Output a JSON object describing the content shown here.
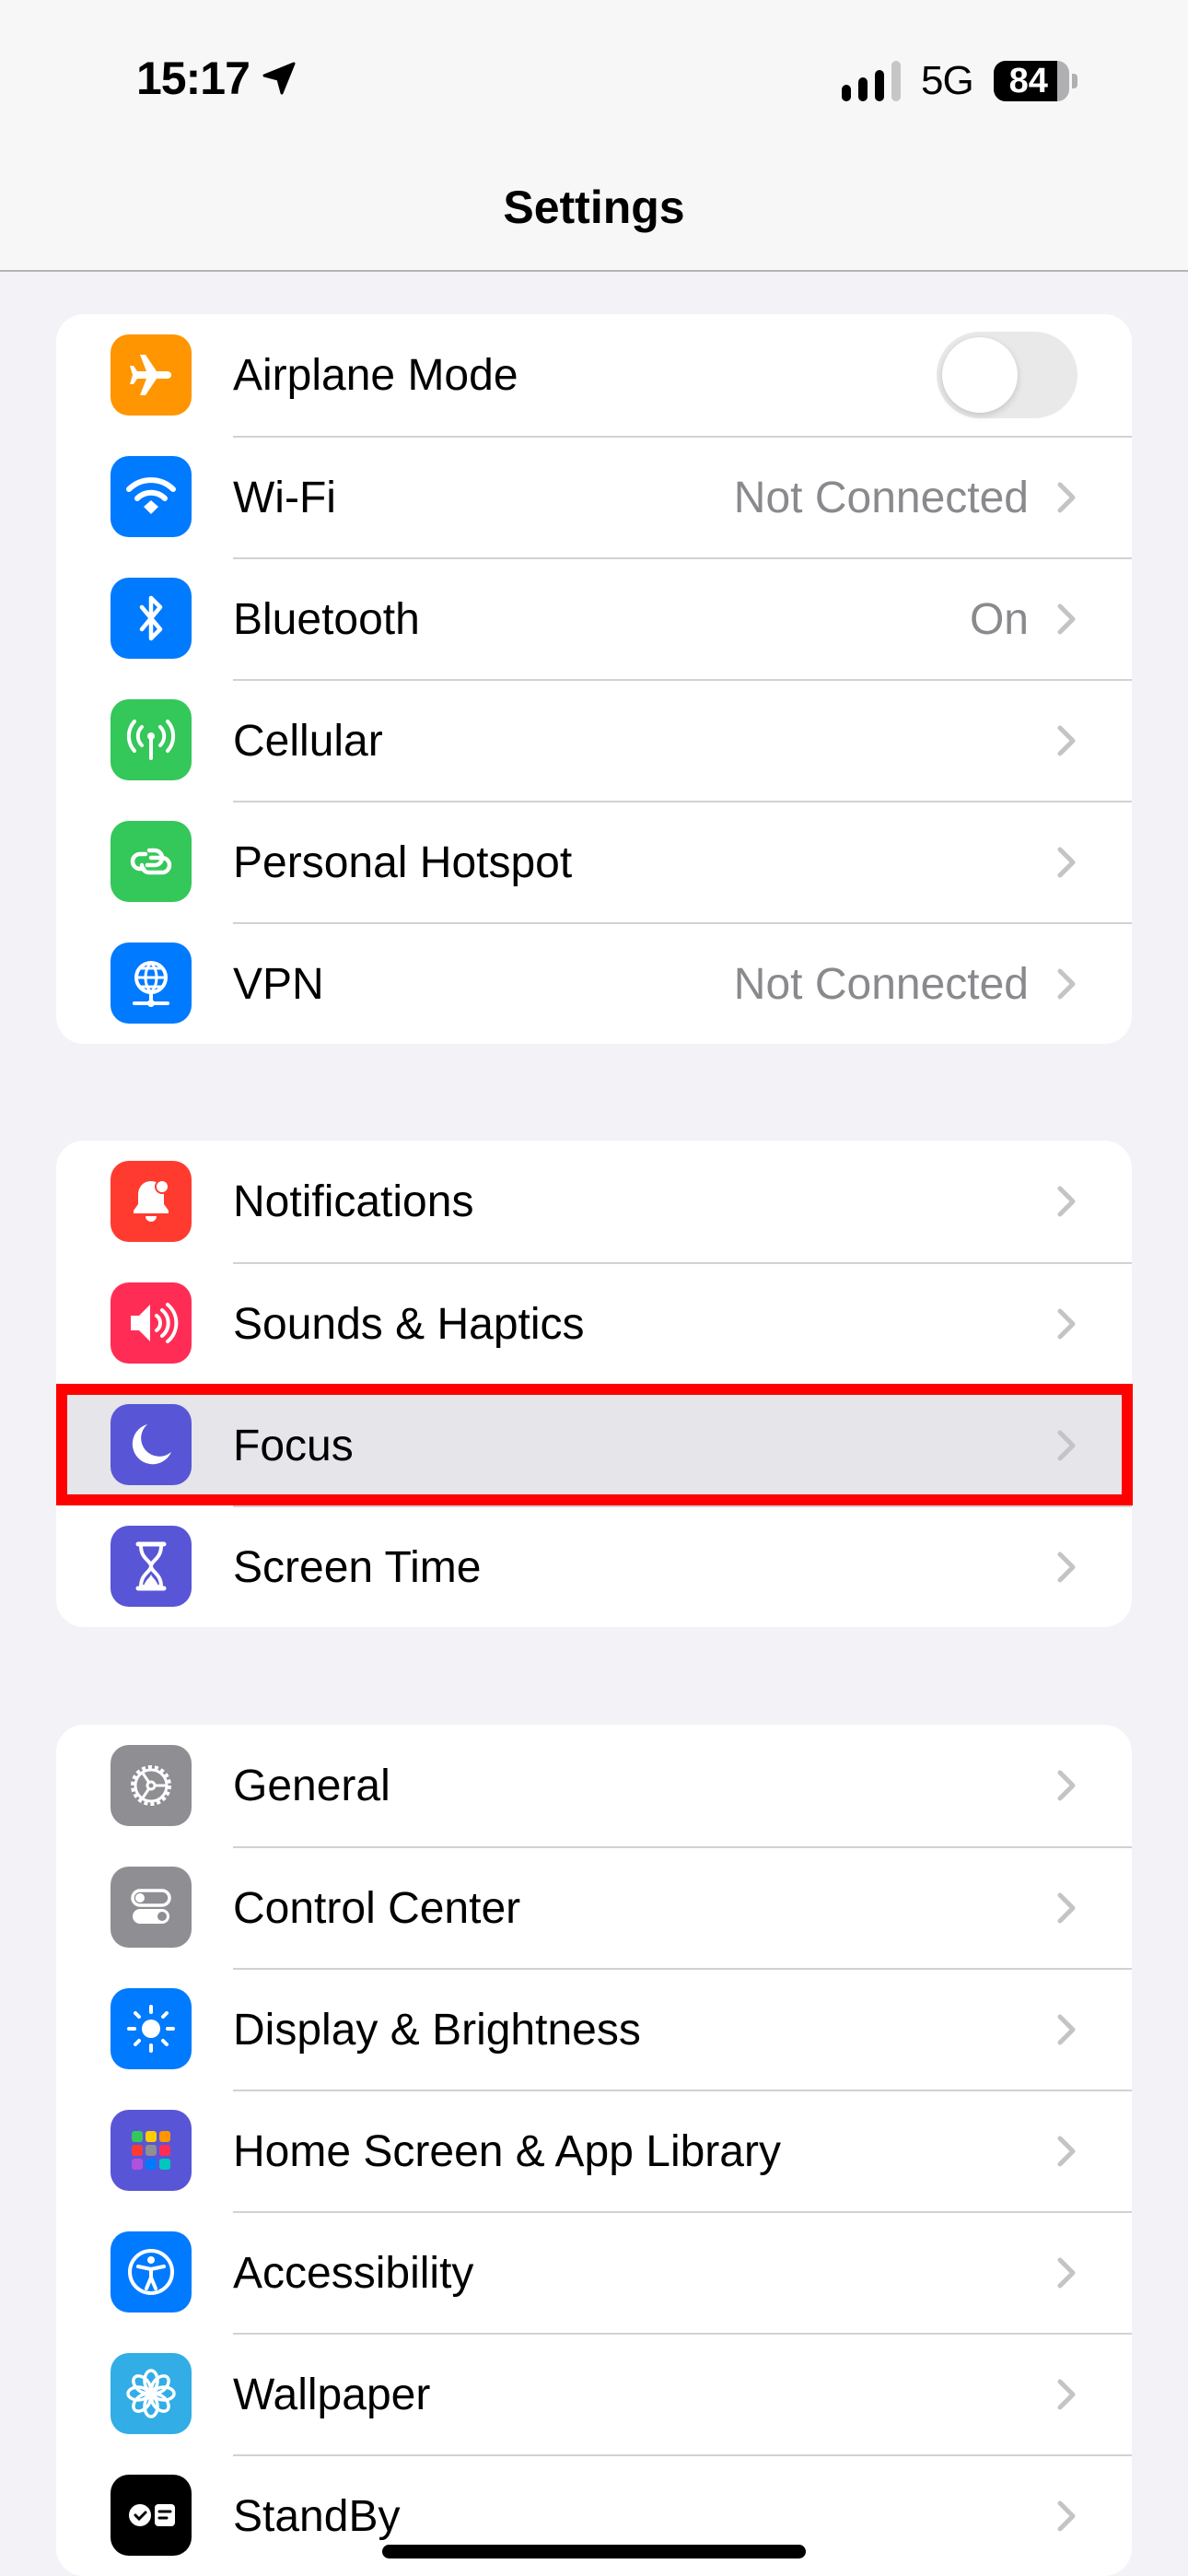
{
  "status_bar": {
    "time": "15:17",
    "location_icon": "location-arrow-icon",
    "signal_bars_active": 3,
    "signal_bars_total": 4,
    "network": "5G",
    "battery_percent": 84
  },
  "nav": {
    "title": "Settings"
  },
  "groups": [
    {
      "items": [
        {
          "label": "Airplane Mode",
          "icon": "airplane-icon",
          "color": "#ff9500",
          "toggle": false
        },
        {
          "label": "Wi-Fi",
          "icon": "wifi-icon",
          "color": "#007aff",
          "value": "Not Connected"
        },
        {
          "label": "Bluetooth",
          "icon": "bluetooth-icon",
          "color": "#007aff",
          "value": "On"
        },
        {
          "label": "Cellular",
          "icon": "cellular-antenna-icon",
          "color": "#34c759"
        },
        {
          "label": "Personal Hotspot",
          "icon": "hotspot-link-icon",
          "color": "#34c759"
        },
        {
          "label": "VPN",
          "icon": "vpn-globe-icon",
          "color": "#007aff",
          "value": "Not Connected"
        }
      ]
    },
    {
      "items": [
        {
          "label": "Notifications",
          "icon": "bell-icon",
          "color": "#ff3b30"
        },
        {
          "label": "Sounds & Haptics",
          "icon": "speaker-icon",
          "color": "#ff2d55"
        },
        {
          "label": "Focus",
          "icon": "moon-icon",
          "color": "#5856d6",
          "highlighted": true
        },
        {
          "label": "Screen Time",
          "icon": "hourglass-icon",
          "color": "#5856d6"
        }
      ]
    },
    {
      "items": [
        {
          "label": "General",
          "icon": "gear-icon",
          "color": "#8e8e93"
        },
        {
          "label": "Control Center",
          "icon": "switches-icon",
          "color": "#8e8e93"
        },
        {
          "label": "Display & Brightness",
          "icon": "sun-icon",
          "color": "#007aff"
        },
        {
          "label": "Home Screen & App Library",
          "icon": "app-grid-icon",
          "color": "#5856d6"
        },
        {
          "label": "Accessibility",
          "icon": "accessibility-icon",
          "color": "#007aff"
        },
        {
          "label": "Wallpaper",
          "icon": "flower-icon",
          "color": "#32ade6"
        },
        {
          "label": "StandBy",
          "icon": "standby-icon",
          "color": "#000000"
        }
      ]
    }
  ],
  "annotation": {
    "highlight_color": "#ff0000",
    "target": "Focus"
  }
}
